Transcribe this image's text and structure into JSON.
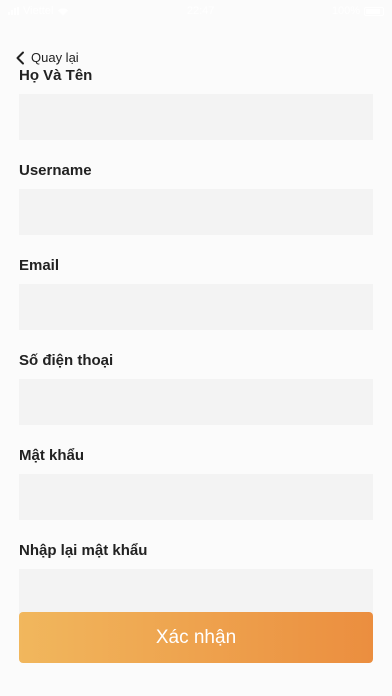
{
  "status_bar": {
    "carrier": "Viettel",
    "time": "22:47",
    "battery": "100%"
  },
  "nav": {
    "back_label": "Quay lại",
    "back_icon": "chevron-left-icon"
  },
  "form": {
    "fields": [
      {
        "label": "Họ Và Tên",
        "value": ""
      },
      {
        "label": "Username",
        "value": ""
      },
      {
        "label": "Email",
        "value": ""
      },
      {
        "label": "Số điện thoại",
        "value": ""
      },
      {
        "label": "Mật khẩu",
        "value": ""
      },
      {
        "label": "Nhập lại mật khẩu",
        "value": ""
      }
    ],
    "submit_label": "Xác nhận"
  },
  "colors": {
    "gradient_start": "#f1b75d",
    "gradient_end": "#eb8e3f",
    "input_bg": "#f3f3f3"
  }
}
